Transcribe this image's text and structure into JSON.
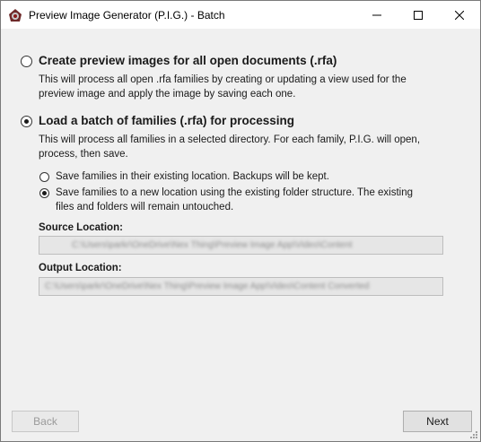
{
  "window": {
    "title": "Preview Image Generator (P.I.G.) - Batch"
  },
  "options": {
    "open_documents": {
      "heading": "Create preview images for all open documents (.rfa)",
      "description_line1": "This will process all open .rfa families by creating or updating a view used for the",
      "description_line2": "preview image and apply the image by saving each one.",
      "selected": false
    },
    "batch": {
      "heading": "Load a batch of families (.rfa) for processing",
      "description_line1": "This will process all families in a selected directory. For each family, P.I.G. will open,",
      "description_line2": "process, then save.",
      "selected": true
    }
  },
  "save_options": {
    "existing_location": {
      "label": "Save families in their existing location. Backups will be kept.",
      "selected": false
    },
    "new_location": {
      "label_line1": "Save families to a new location using the existing folder structure. The existing",
      "label_line2": "files and folders will remain untouched.",
      "selected": true
    }
  },
  "source": {
    "label": "Source Location:",
    "value": "C:\\Users\\parkr\\OneDrive\\Nex Thing\\Preview Image App\\Video\\Content"
  },
  "output": {
    "label": "Output Location:",
    "value": "C:\\Users\\parkr\\OneDrive\\Nex Thing\\Preview Image App\\Video\\Content Converted"
  },
  "buttons": {
    "back": "Back",
    "next": "Next"
  },
  "icons": {
    "app": "pig-app-icon",
    "minimize": "minimize-icon",
    "maximize": "maximize-icon",
    "close": "close-icon",
    "resize": "resize-grip-icon"
  }
}
